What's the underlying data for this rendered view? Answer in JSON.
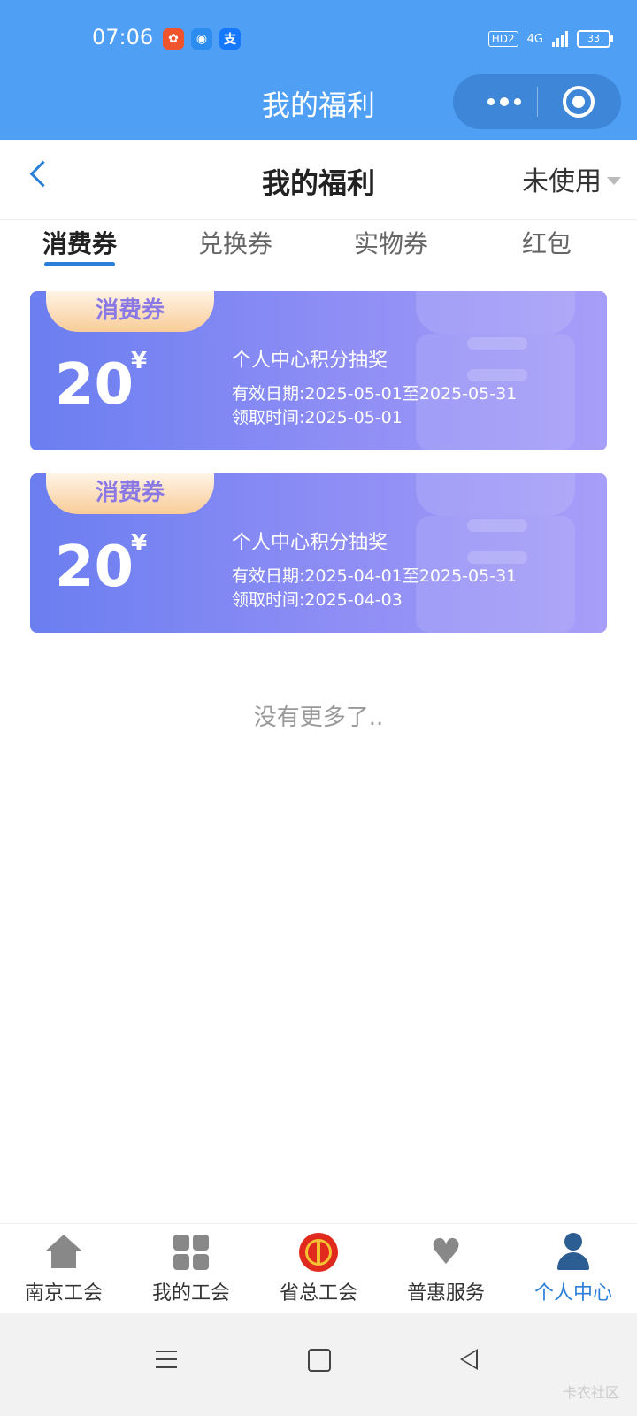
{
  "status_bar": {
    "time": "07:06",
    "apps": [
      {
        "icon": "app-icon-orange",
        "glyph": "",
        "color": "#f0542d"
      },
      {
        "icon": "app-icon-blue-wave",
        "glyph": "",
        "color": "#2d8cf0"
      },
      {
        "icon": "alipay-icon",
        "glyph": "支",
        "color": "#1677ff"
      }
    ],
    "hd": "HD2",
    "network": "4G",
    "battery": "33"
  },
  "mini_program": {
    "title": "我的福利",
    "capsule": {
      "more_icon": "more-dots-icon",
      "close_icon": "target-close-icon"
    }
  },
  "navbar": {
    "title": "我的福利",
    "filter": "未使用"
  },
  "tabs": [
    {
      "label": "消费券",
      "active": true
    },
    {
      "label": "兑换券",
      "active": false
    },
    {
      "label": "实物券",
      "active": false
    },
    {
      "label": "红包",
      "active": false
    }
  ],
  "coupons": [
    {
      "tag": "消费券",
      "amount": "20",
      "currency": "¥",
      "name": "个人中心积分抽奖",
      "valid_label": "有效日期:",
      "valid_range": "2025-05-01至2025-05-31",
      "received_label": "领取时间:",
      "received_date": "2025-05-01"
    },
    {
      "tag": "消费券",
      "amount": "20",
      "currency": "¥",
      "name": "个人中心积分抽奖",
      "valid_label": "有效日期:",
      "valid_range": "2025-04-01至2025-05-31",
      "received_label": "领取时间:",
      "received_date": "2025-04-03"
    }
  ],
  "no_more": "没有更多了..",
  "tabbar": [
    {
      "label": "南京工会",
      "icon": "home-icon"
    },
    {
      "label": "我的工会",
      "icon": "grid-icon"
    },
    {
      "label": "省总工会",
      "icon": "union-emblem-icon"
    },
    {
      "label": "普惠服务",
      "icon": "heart-icon"
    },
    {
      "label": "个人中心",
      "icon": "user-icon",
      "active": true
    }
  ],
  "colors": {
    "header": "#4f9ff5",
    "accent": "#2b7fd8",
    "card_start": "#6b7ef0",
    "card_end": "#a79ef8",
    "tag_text": "#8a79e4"
  },
  "watermark": "卡农社区"
}
